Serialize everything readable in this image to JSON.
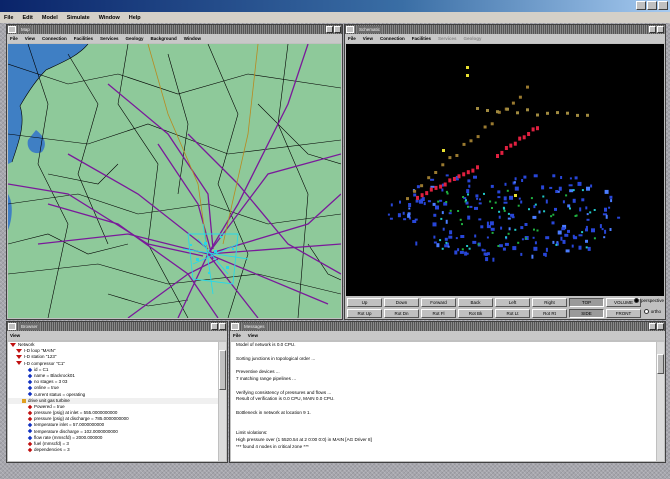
{
  "menubar": [
    "File",
    "Edit",
    "Model",
    "Simulate",
    "Window",
    "Help"
  ],
  "map_window": {
    "title": "Map",
    "menu": [
      "File",
      "View",
      "Connection",
      "Facilities",
      "Services",
      "Geology",
      "Background",
      "Window"
    ],
    "colors": {
      "land": "#8ec99a",
      "sea": "#3f7fc4",
      "pipe": "#7a1a9a",
      "road": "#000000",
      "cyan": "#28d8e8"
    }
  },
  "schematic_window": {
    "title": "Schematic",
    "menu": [
      "File",
      "View",
      "Connection",
      "Facilities",
      "Services",
      "Geology"
    ],
    "buttons_row1": [
      "Up",
      "Down",
      "Forward",
      "Back",
      "Left",
      "Right",
      "TOP",
      "VOLUME"
    ],
    "buttons_row2": [
      "Rot Up",
      "Rot Dn",
      "Rot Fl",
      "Rot Bk",
      "Rot Lt",
      "Rot Rt",
      "SIDE",
      "FRONT"
    ],
    "active_buttons": [
      "TOP",
      "SIDE"
    ],
    "radio": [
      "perspective",
      "ortho"
    ]
  },
  "tree_window": {
    "title": "Browser",
    "menu": [
      "View"
    ],
    "rows": [
      {
        "text": "Network",
        "indent": 0,
        "color": "#c01010",
        "shape": "tri"
      },
      {
        "text": "I-D loop \"MAIN\"",
        "indent": 1,
        "color": "#c01010",
        "shape": "tri"
      },
      {
        "text": "I-D station \"123\"",
        "indent": 1,
        "color": "#c01010",
        "shape": "tri"
      },
      {
        "text": "I-D compressor \"C1\"",
        "indent": 1,
        "color": "#c01010",
        "shape": "tri"
      },
      {
        "text": "id = C1",
        "indent": 3,
        "color": "#1030c0",
        "shape": "dia"
      },
      {
        "text": "name = Blackrock01",
        "indent": 3,
        "color": "#1030c0",
        "shape": "dia"
      },
      {
        "text": "no stages = 3 03",
        "indent": 3,
        "color": "#1030c0",
        "shape": "dia"
      },
      {
        "text": "online = true",
        "indent": 3,
        "color": "#1030c0",
        "shape": "dia"
      },
      {
        "text": "current status = operating",
        "indent": 3,
        "color": "#1030c0",
        "shape": "dia"
      },
      {
        "text": "drive unit gas turbine",
        "indent": 2,
        "color": "#e0a020",
        "shape": "box",
        "hl": true
      },
      {
        "text": "Powered = true",
        "indent": 3,
        "color": "#c01010",
        "shape": "dia"
      },
      {
        "text": "pressure (psig) at inlet = 555.0000000000",
        "indent": 3,
        "color": "#c01010",
        "shape": "dia"
      },
      {
        "text": "pressure (psig) at discharge = 785.0000000000",
        "indent": 3,
        "color": "#c01010",
        "shape": "dia"
      },
      {
        "text": "temperature inlet = 57.0000000000",
        "indent": 3,
        "color": "#1030c0",
        "shape": "dia"
      },
      {
        "text": "temperature discharge = 102.0000000000",
        "indent": 3,
        "color": "#1030c0",
        "shape": "dia"
      },
      {
        "text": "flow rate (mmscfd) = 2000.000000",
        "indent": 3,
        "color": "#1030c0",
        "shape": "dia"
      },
      {
        "text": "fuel (mmscfd) = 3",
        "indent": 3,
        "color": "#c01010",
        "shape": "dia"
      },
      {
        "text": "dependencies = 3",
        "indent": 3,
        "color": "#c01010",
        "shape": "dia"
      }
    ]
  },
  "message_window": {
    "title": "Messages",
    "menu": [
      "File",
      "View"
    ],
    "lines": [
      "Model of network is 0.0 CPU.",
      "",
      "Sorting junctions in topological order ...",
      "",
      "Preventive devices ...",
      "  7 matching range pipelines ...",
      "",
      "Verifying consistency of pressures and flows ...",
      "  Result of verification is 0.0 CPU, MAIN 0.0 CPU.",
      "",
      "Bottleneck in network at location 9 1.",
      "",
      "",
      "Limit violations:",
      "  High pressure over (1 5520.54 at 2 0:00 0:0) in MAIN [AG Driver 8]",
      "  *** found 4 nodes in critical zone ***"
    ]
  }
}
